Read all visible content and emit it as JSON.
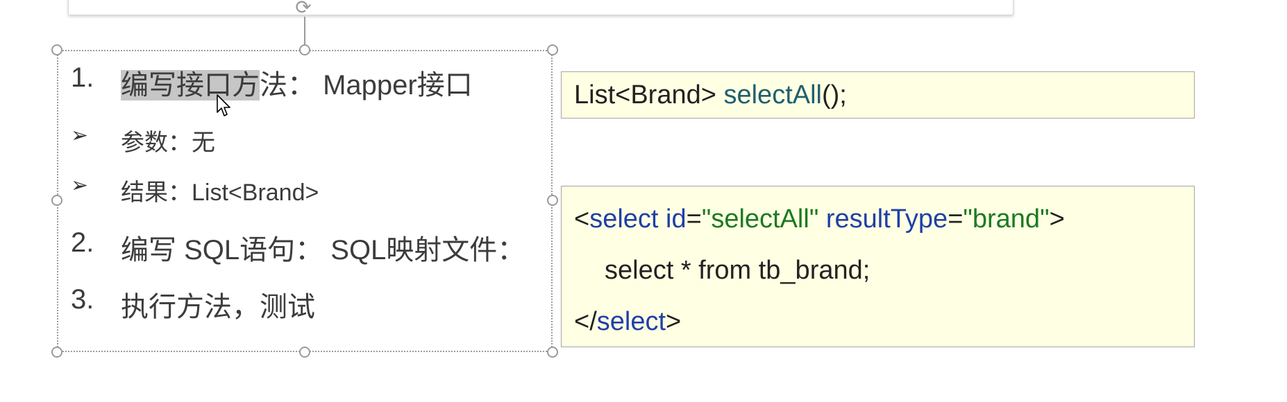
{
  "slide": {
    "steps": [
      {
        "num": "1.",
        "text_hl": "编写接口方",
        "text_rest": "法：  Mapper接口"
      },
      {
        "num": "2.",
        "text": "编写 SQL语句：  SQL映射文件："
      },
      {
        "num": "3.",
        "text": "执行方法，测试"
      }
    ],
    "bullets": [
      {
        "text": "参数：无"
      },
      {
        "text": "结果：List<Brand>"
      }
    ],
    "code_method": {
      "part1": "List<Brand> ",
      "part2": "selectAll",
      "part3": "();"
    },
    "code_xml": {
      "l1_open": "<",
      "l1_tag": "select",
      "l1_attr1": " id",
      "l1_eq1": "=",
      "l1_val1": "\"selectAll\"",
      "l1_attr2": " resultType",
      "l1_eq2": "=",
      "l1_val2": "\"brand\"",
      "l1_close": ">",
      "l2": "select * from tb_brand;",
      "l3_open": "</",
      "l3_tag": "select",
      "l3_close": ">"
    }
  },
  "colors": {
    "code_bg": "#ffffe3",
    "keyword": "#1f3fa8",
    "string": "#1c7a22",
    "method": "#1f5f70",
    "highlight": "#c6c6c6"
  }
}
